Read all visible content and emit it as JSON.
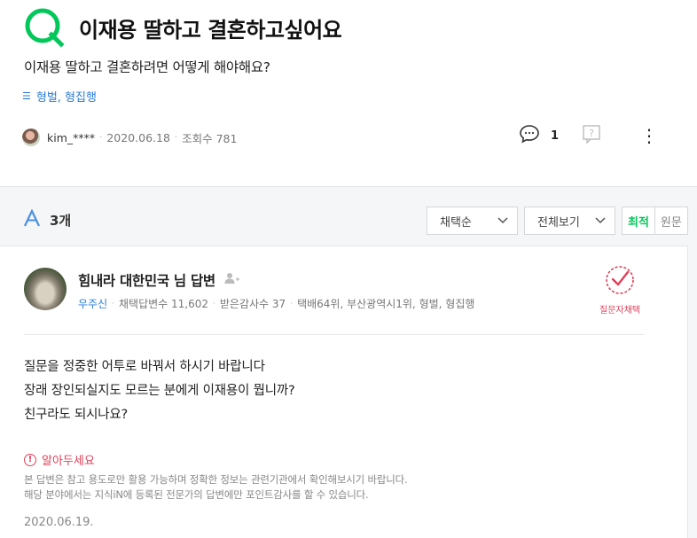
{
  "question": {
    "badge": "Q",
    "title": "이재용 딸하고 결혼하고싶어요",
    "body": "이재용 딸하고 결혼하려면 어떻게 해야해요?",
    "tags_icon": "list-icon",
    "tags": "형벌, 형집행",
    "author": "kim_****",
    "date": "2020.06.18",
    "views": "조회수 781",
    "comment_count": "1"
  },
  "answers_header": {
    "badge": "A",
    "count": "3개",
    "sort_value": "채택순",
    "filter_value": "전체보기",
    "seg_best": "최적",
    "seg_original": "원문"
  },
  "answer": {
    "name": "힘내라 대한민국 님 답변",
    "grade": "우주신",
    "adopt_count": "채택답변수 11,602",
    "thanks": "받은감사수 37",
    "ranks": "택배64위, 부산광역시1위, 형벌, 형집행",
    "chosen_label": "질문자채택",
    "body_lines": [
      "질문을 정중한 어투로 바꿔서 하시기 바랍니다",
      "장래 장인되실지도 모르는 분에게 이재용이 뭡니까?",
      "친구라도 되시나요?"
    ],
    "notice_title": "알아두세요",
    "notice_lines": [
      "본 답변은 참고 용도로만 활용 가능하며 정확한 정보는 관련기관에서 확인해보시기 바랍니다.",
      "해당 분야에서는 지식iN에 등록된 전문가의 답변에만 포인트감사를 할 수 있습니다."
    ],
    "date": "2020.06.19."
  },
  "colors": {
    "brand_green": "#03c75a",
    "link_blue": "#2a7cd6",
    "accent_red": "#e0405a"
  }
}
